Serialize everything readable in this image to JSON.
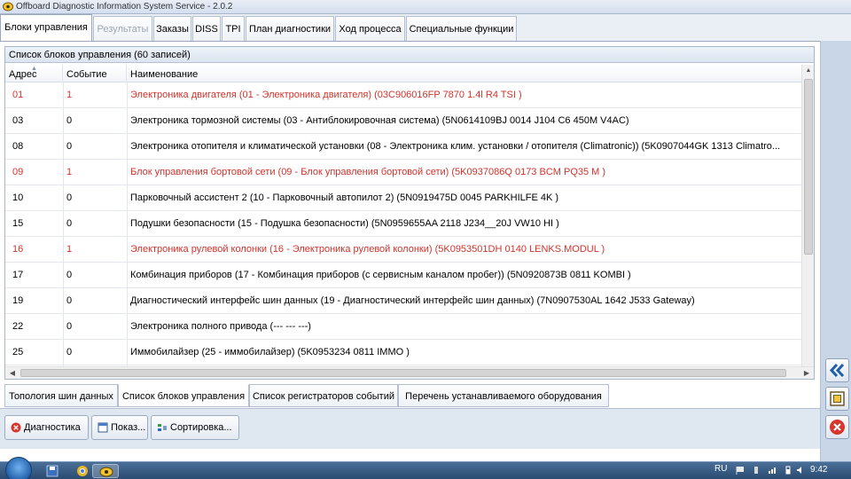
{
  "window": {
    "title": "Offboard Diagnostic Information System Service - 2.0.2"
  },
  "tabs": [
    {
      "label": "Блоки управления",
      "state": "active"
    },
    {
      "label": "Результаты",
      "state": "disabled"
    },
    {
      "label": "Заказы",
      "state": "normal"
    },
    {
      "label": "DISS",
      "state": "normal"
    },
    {
      "label": "TPI",
      "state": "normal"
    },
    {
      "label": "План диагностики",
      "state": "normal"
    },
    {
      "label": "Ход процесса",
      "state": "normal"
    },
    {
      "label": "Специальные функции",
      "state": "normal"
    }
  ],
  "panel": {
    "title": "Список блоков управления (60 записей)"
  },
  "table": {
    "columns": [
      "Адрес",
      "Событие",
      "Наименование"
    ],
    "rows": [
      {
        "address": "01",
        "event": "1",
        "name": "Электроника двигателя (01 - Электроника двигателя) (03C906016FP   7870   1.4l R4 TSI  )",
        "highlight": true
      },
      {
        "address": "03",
        "event": "0",
        "name": "Электроника тормозной системы (03 - Антиблокировочная система) (5N0614109BJ    0014   J104   C6 450M V4AC)",
        "highlight": false
      },
      {
        "address": "08",
        "event": "0",
        "name": "Электроника отопителя и климатической установки (08 - Электроника клим. установки / отопителя  (Climatronic)) (5K0907044GK   1313   Climatro...",
        "highlight": false
      },
      {
        "address": "09",
        "event": "1",
        "name": "Блок управления бортовой сети (09 - Блок управления бортовой сети) (5K0937086Q    0173   BCM PQ35 M   )",
        "highlight": true
      },
      {
        "address": "10",
        "event": "0",
        "name": "Парковочный ассистент 2 (10 - Парковочный автопилот 2) (5N0919475D     0045    PARKHILFE 4K )",
        "highlight": false
      },
      {
        "address": "15",
        "event": "0",
        "name": "Подушки безопасности (15 - Подушка безопасности) (5N0959655AA    2118   J234__20J VW10 HI  )",
        "highlight": false
      },
      {
        "address": "16",
        "event": "1",
        "name": "Электроника рулевой колонки (16 - Электроника рулевой колонки) (5K0953501DH    0140    LENKS.MODUL  )",
        "highlight": true
      },
      {
        "address": "17",
        "event": "0",
        "name": "Комбинация приборов (17 - Комбинация приборов (с сервисным каналом пробег)) (5N0920873B    0811   KOMBI        )",
        "highlight": false
      },
      {
        "address": "19",
        "event": "0",
        "name": "Диагностический интерфейс шин данных (19 - Диагностический интерфейс шин данных) (7N0907530AL   1642   J533  Gateway)",
        "highlight": false
      },
      {
        "address": "22",
        "event": "0",
        "name": "Электроника полного привода (---    ---    ---)",
        "highlight": false
      },
      {
        "address": "25",
        "event": "0",
        "name": "Иммобилайзер (25 - иммобилайзер) (5K0953234     0811   IMMO        )",
        "highlight": false
      }
    ]
  },
  "bottom_tabs": [
    {
      "label": "Топология шин данных",
      "active": false
    },
    {
      "label": "Список блоков управления",
      "active": true
    },
    {
      "label": "Список регистраторов событий",
      "active": false
    },
    {
      "label": "Перечень устанавливаемого оборудования",
      "active": false
    }
  ],
  "actions": {
    "diagnostics_label": "Диагностика",
    "show_label": "Показ...",
    "sort_label": "Сортировка..."
  },
  "side_buttons": {
    "back_icon": "double-chevron-left-icon",
    "screenshot_icon": "frame-icon",
    "close_icon": "close-circle-icon"
  },
  "taskbar": {
    "language": "RU",
    "time": "9:42"
  },
  "colors": {
    "highlight_row": "#d0332b",
    "side_back": "#1f5fa8",
    "side_close": "#d6362b"
  }
}
